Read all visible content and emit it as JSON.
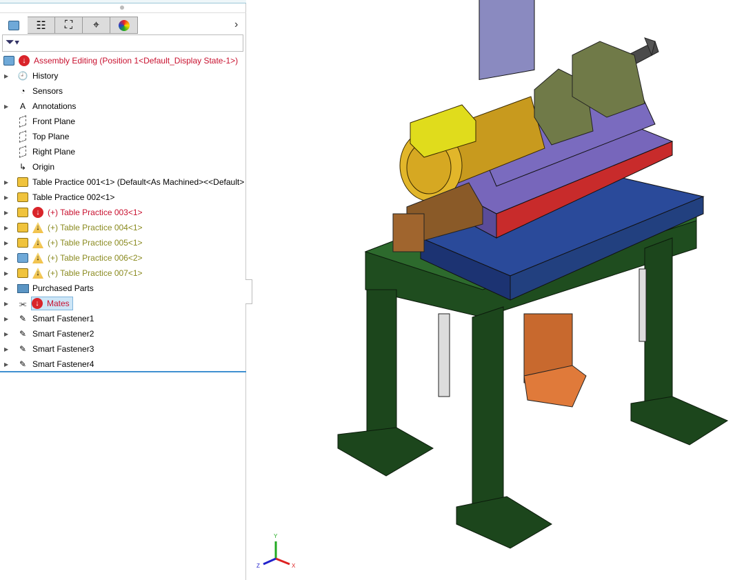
{
  "tabs": [
    {
      "icon": "feature-manager-icon"
    },
    {
      "icon": "property-manager-icon"
    },
    {
      "icon": "configuration-manager-icon"
    },
    {
      "icon": "dimxpert-icon"
    },
    {
      "icon": "display-manager-icon"
    }
  ],
  "tree": {
    "root": {
      "label": "Assembly Editing  (Position 1<Default_Display State-1>)",
      "status": "error"
    },
    "items": [
      {
        "label": "History",
        "icon": "history-icon",
        "expand": true
      },
      {
        "label": "Sensors",
        "icon": "sensor-icon",
        "expand": false
      },
      {
        "label": "Annotations",
        "icon": "annotations-icon",
        "expand": true
      },
      {
        "label": "Front Plane",
        "icon": "plane-icon",
        "expand": false
      },
      {
        "label": "Top Plane",
        "icon": "plane-icon",
        "expand": false
      },
      {
        "label": "Right Plane",
        "icon": "plane-icon",
        "expand": false
      },
      {
        "label": "Origin",
        "icon": "origin-icon",
        "expand": false
      },
      {
        "label": "Table Practice 001<1> (Default<As Machined><<Default>",
        "icon": "part-icon",
        "expand": true
      },
      {
        "label": "Table Practice 002<1>",
        "icon": "part-icon",
        "expand": true
      },
      {
        "label": "(+) Table Practice 003<1>",
        "icon": "part-icon",
        "status": "error",
        "expand": true
      },
      {
        "label": "(+) Table Practice 004<1>",
        "icon": "part-icon",
        "status": "warning",
        "expand": true
      },
      {
        "label": "(+) Table Practice 005<1>",
        "icon": "part-icon",
        "status": "warning",
        "expand": true
      },
      {
        "label": "(+) Table Practice 006<2>",
        "icon": "assembly-icon",
        "status": "warning",
        "expand": true
      },
      {
        "label": "(+) Table Practice 007<1>",
        "icon": "part-icon",
        "status": "warning",
        "expand": true
      },
      {
        "label": "Purchased Parts",
        "icon": "folder-icon",
        "expand": true
      },
      {
        "label": "Mates",
        "icon": "mates-icon",
        "status": "error",
        "expand": true,
        "selected": true
      },
      {
        "label": "Smart Fastener1",
        "icon": "smart-fastener-icon",
        "expand": true
      },
      {
        "label": "Smart Fastener2",
        "icon": "smart-fastener-icon",
        "expand": true
      },
      {
        "label": "Smart Fastener3",
        "icon": "smart-fastener-icon",
        "expand": true
      },
      {
        "label": "Smart Fastener4",
        "icon": "smart-fastener-icon",
        "expand": true
      }
    ]
  },
  "triad": {
    "x": "X",
    "y": "Y",
    "z": "Z"
  }
}
